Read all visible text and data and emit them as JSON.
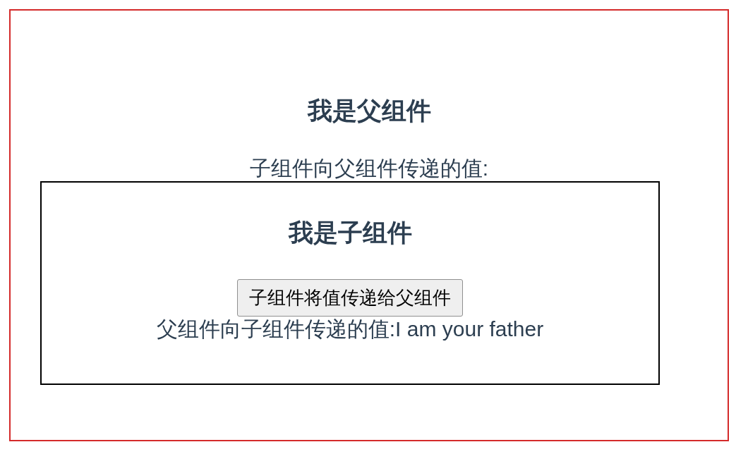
{
  "parent": {
    "title": "我是父组件",
    "received_label": "子组件向父组件传递的值:"
  },
  "child": {
    "title": "我是子组件",
    "button": "子组件将值传递给父组件",
    "received_text": "父组件向子组件传递的值:I am your father"
  }
}
